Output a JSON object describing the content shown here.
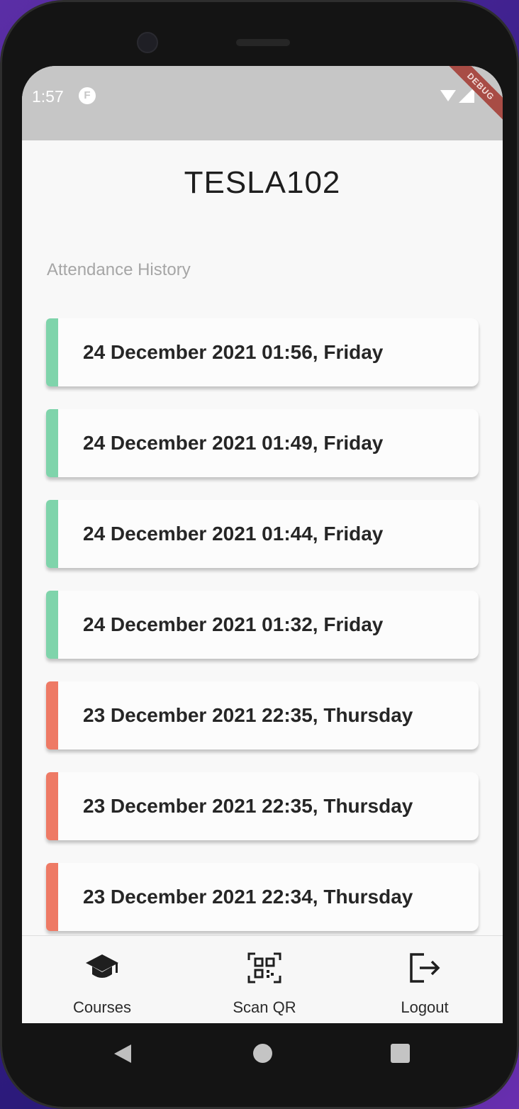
{
  "status_bar": {
    "time": "1:57",
    "app_icon": "F",
    "debug_label": "DEBUG"
  },
  "page": {
    "title": "TESLA102",
    "section_label": "Attendance History"
  },
  "colors": {
    "present": "#7fd4ab",
    "absent": "#ee7a65"
  },
  "history": [
    {
      "text": "24 December 2021 01:56, Friday",
      "status": "present"
    },
    {
      "text": "24 December 2021 01:49, Friday",
      "status": "present"
    },
    {
      "text": "24 December 2021 01:44, Friday",
      "status": "present"
    },
    {
      "text": "24 December 2021 01:32, Friday",
      "status": "present"
    },
    {
      "text": "23 December 2021 22:35, Thursday",
      "status": "absent"
    },
    {
      "text": "23 December 2021 22:35, Thursday",
      "status": "absent"
    },
    {
      "text": "23 December 2021 22:34, Thursday",
      "status": "absent"
    }
  ],
  "bottom_nav": {
    "courses": {
      "label": "Courses",
      "icon": "graduation-cap-icon"
    },
    "scan": {
      "label": "Scan QR",
      "icon": "qr-code-icon"
    },
    "logout": {
      "label": "Logout",
      "icon": "logout-icon"
    }
  }
}
